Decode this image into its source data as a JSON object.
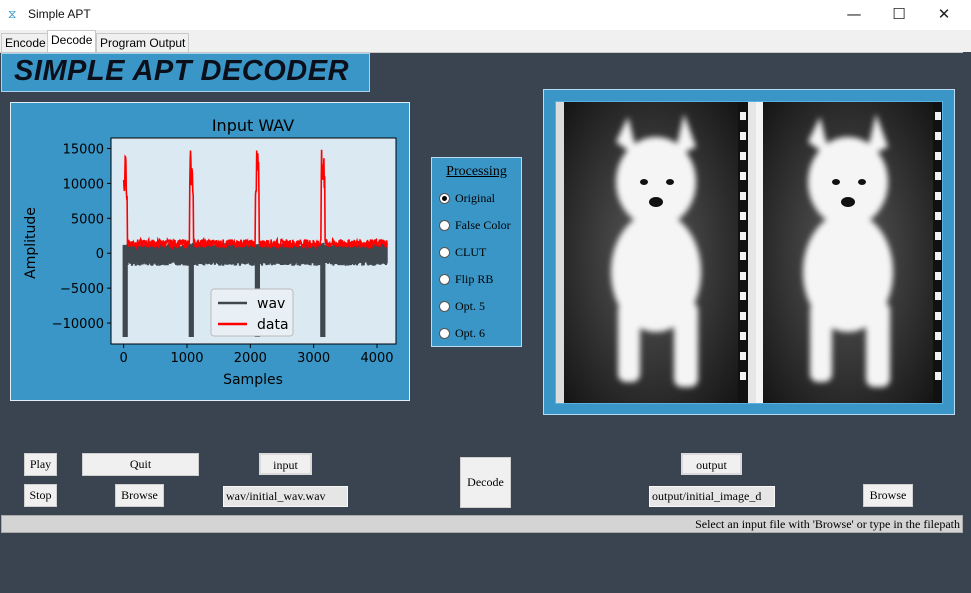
{
  "window": {
    "title": "Simple APT",
    "icon": "waveform-icon",
    "minimize_glyph": "—",
    "maximize_glyph": "☐",
    "close_glyph": "✕"
  },
  "tabs": [
    {
      "label": "Encode",
      "active": false
    },
    {
      "label": "Decode",
      "active": true
    },
    {
      "label": "Program Output",
      "active": false
    }
  ],
  "header": {
    "title": "SIMPLE APT DECODER"
  },
  "processing": {
    "title": "Processing",
    "options": [
      "Original",
      "False Color",
      "CLUT",
      "Flip RB",
      "Opt. 5",
      "Opt. 6"
    ],
    "selected_index": 0
  },
  "controls": {
    "play_label": "Play",
    "stop_label": "Stop",
    "quit_label": "Quit",
    "browse_input_label": "Browse",
    "input_label": "input",
    "input_value": "wav/initial_wav.wav",
    "decode_label": "Decode",
    "output_label": "output",
    "output_value": "output/initial_image_d",
    "browse_output_label": "Browse"
  },
  "status": {
    "text": "Select an input file with 'Browse' or type in the filepath"
  },
  "colors": {
    "background": "#3a4451",
    "panel": "#3a96c6",
    "wav_series": "#3f474f",
    "data_series": "#ff0000"
  },
  "chart_data": {
    "type": "line",
    "title": "Input WAV",
    "xlabel": "Samples",
    "ylabel": "Amplitude",
    "xlim": [
      -200,
      4300
    ],
    "ylim": [
      -13000,
      16500
    ],
    "xticks": [
      0,
      1000,
      2000,
      3000,
      4000
    ],
    "yticks": [
      15000,
      10000,
      5000,
      0,
      -5000,
      -10000
    ],
    "ytick_labels": [
      "15000",
      "10000",
      "5000",
      "0",
      "−5000",
      "−10000"
    ],
    "legend_position": "lower-center",
    "pulse_positions": [
      0,
      1040,
      2080,
      3120
    ],
    "series": [
      {
        "name": "wav",
        "color": "#3f474f",
        "upper": 1500,
        "lower": -1800,
        "spike_low": -12000
      },
      {
        "name": "data",
        "color": "#ff0000",
        "upper": 2000,
        "lower": 800,
        "spike_high": [
          14200,
          15000,
          14800,
          14900
        ]
      }
    ]
  }
}
